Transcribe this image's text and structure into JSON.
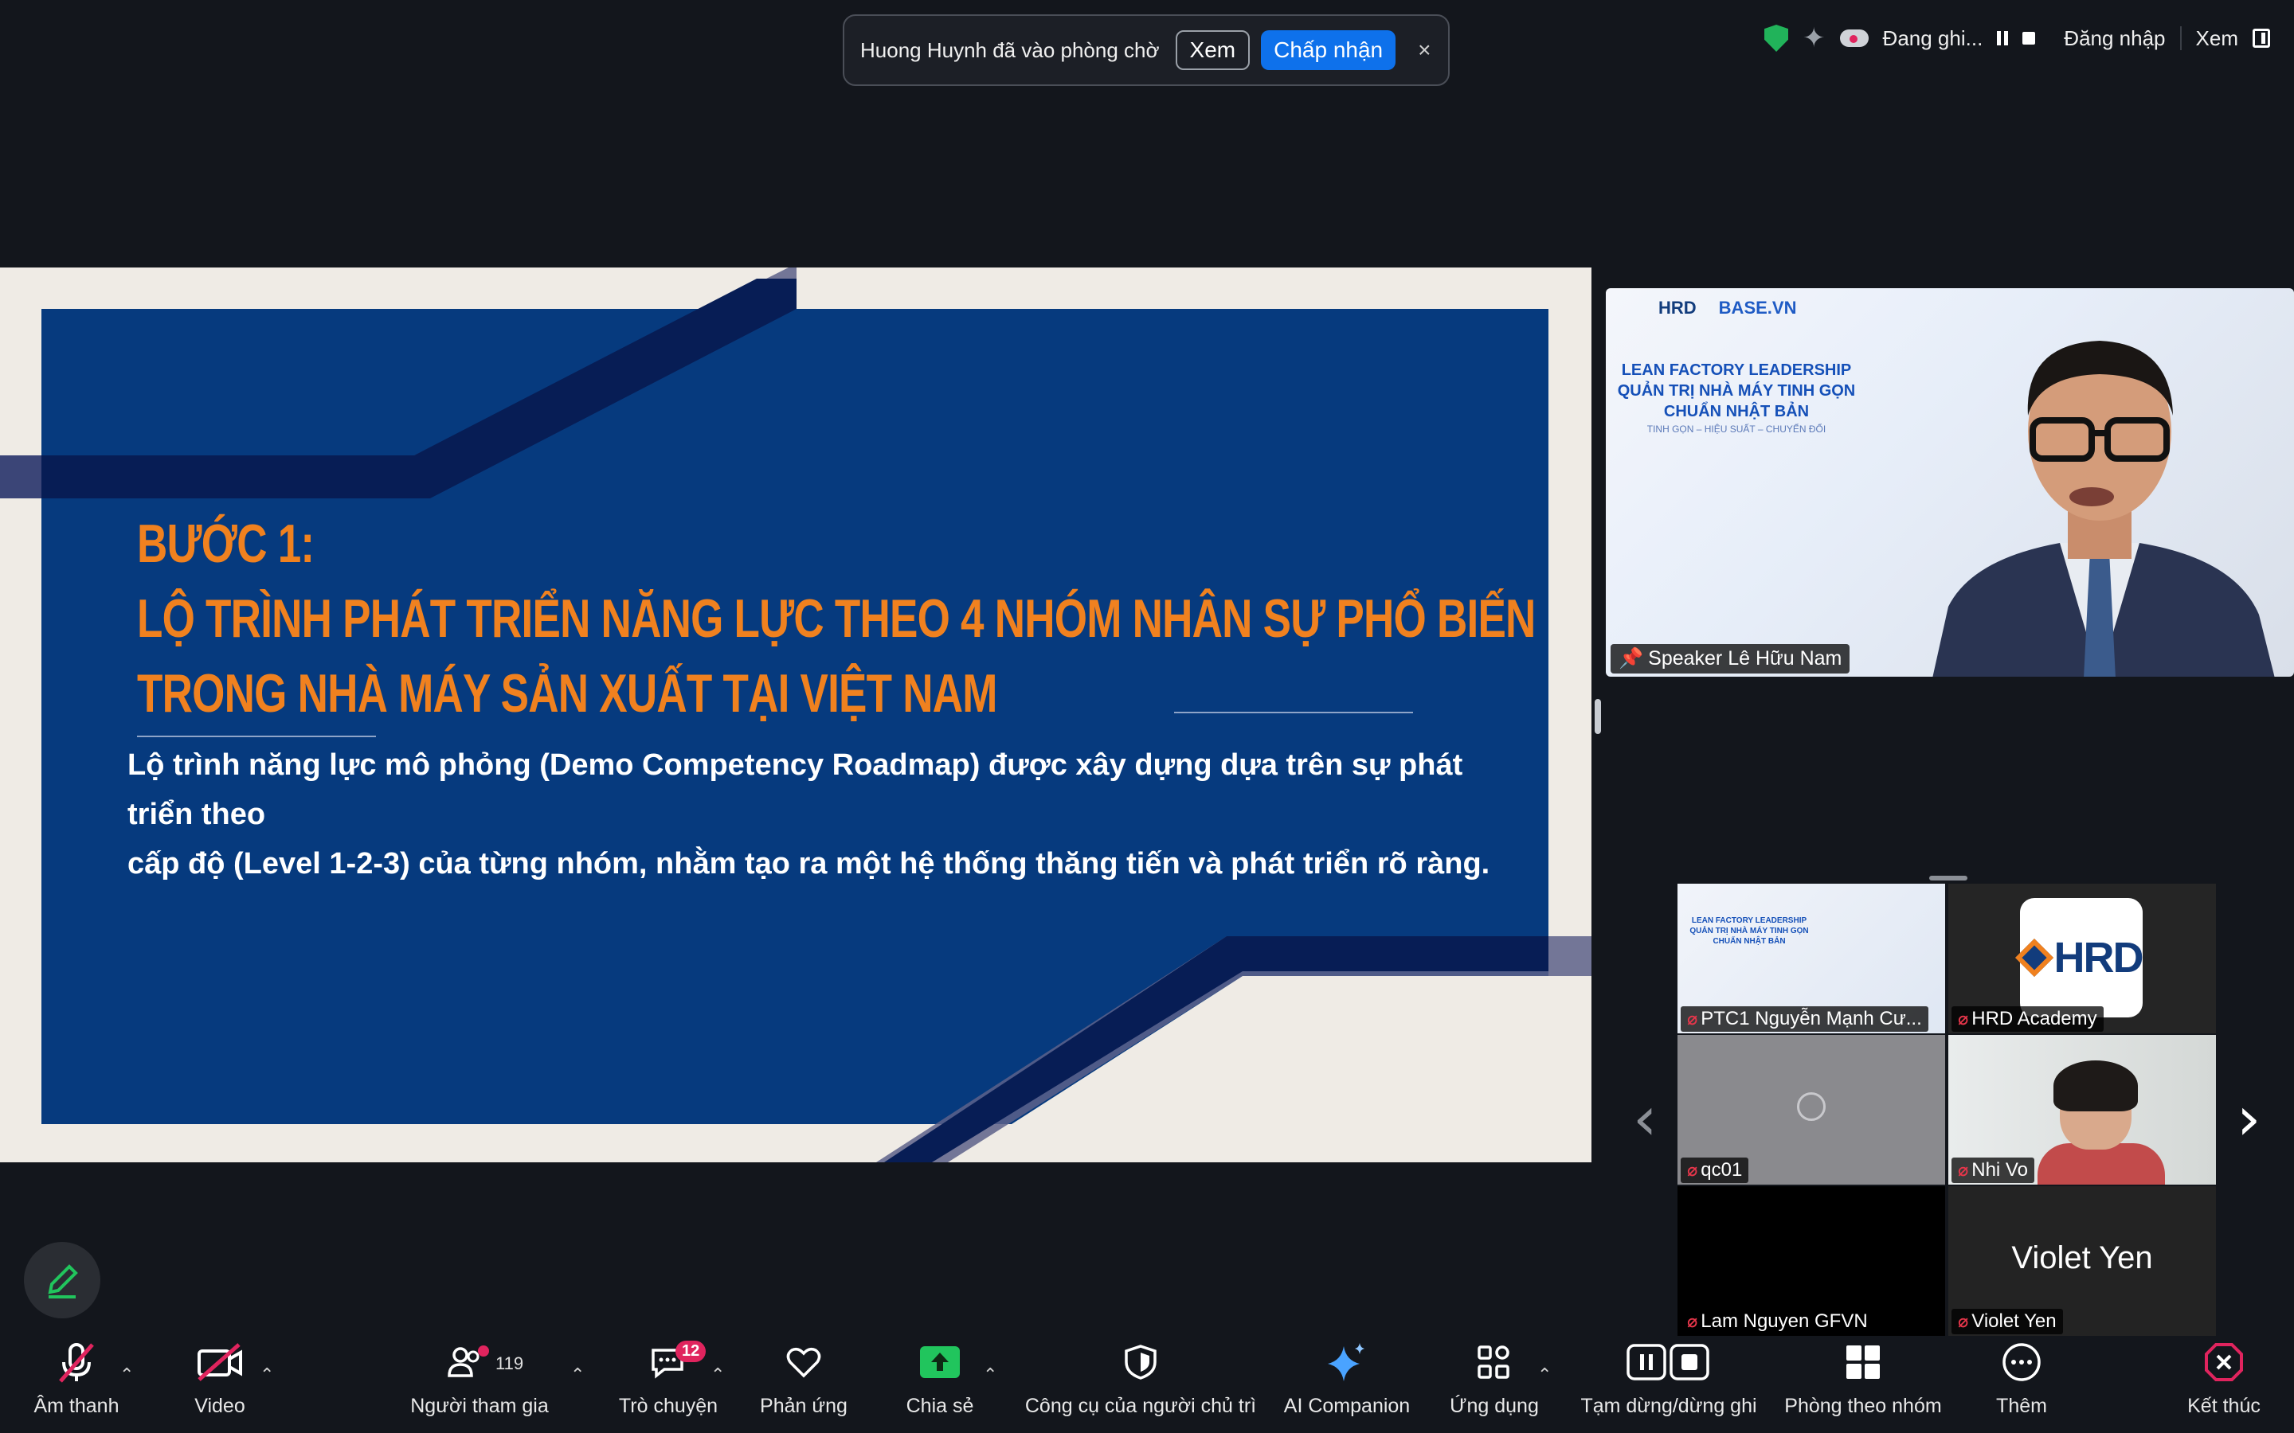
{
  "notification": {
    "message": "Huong Huynh đã vào phòng chờ",
    "view_label": "Xem",
    "accept_label": "Chấp nhận",
    "close_label": "×"
  },
  "status": {
    "recording_label": "Đang ghi...",
    "signin_label": "Đăng nhập",
    "view_label": "Xem"
  },
  "slide": {
    "title_line1": "BƯỚC 1:",
    "title_line2": "LỘ TRÌNH PHÁT TRIỂN NĂNG LỰC THEO 4 NHÓM NHÂN SỰ PHỔ BIẾN",
    "title_line3": "TRONG NHÀ MÁY SẢN XUẤT TẠI VIỆT NAM",
    "body_line1": "Lộ trình năng lực mô phỏng (Demo Competency Roadmap) được xây dựng dựa trên sự phát triển theo",
    "body_line2": "cấp độ (Level 1-2-3) của từng nhóm, nhằm tạo ra một hệ thống thăng tiến và phát triển rõ ràng."
  },
  "speaker": {
    "name": "Speaker Lê Hữu Nam",
    "logo_hrd": "HRD",
    "logo_base": "BASE.VN",
    "webinar_title": "LEAN FACTORY LEADERSHIP QUẢN TRỊ NHÀ MÁY TINH GỌN CHUẨN NHẬT BẢN",
    "webinar_sub": "TINH GỌN – HIỆU SUẤT – CHUYỂN ĐỔI"
  },
  "participants": [
    {
      "name": "PTC1 Nguyễn Mạnh Cư..."
    },
    {
      "name": "HRD Academy",
      "logo_text": "HRD"
    },
    {
      "name": "qc01"
    },
    {
      "name": "Nhi Vo"
    },
    {
      "name": "Lam Nguyen GFVN"
    },
    {
      "name": "Violet Yen",
      "display": "Violet Yen"
    }
  ],
  "toolbar": {
    "audio": "Âm thanh",
    "video": "Video",
    "participants": "Người tham gia",
    "participants_count": "119",
    "chat": "Trò chuyện",
    "chat_badge": "12",
    "reactions": "Phản ứng",
    "share": "Chia sẻ",
    "host_tools": "Công cụ của người chủ trì",
    "ai_companion": "AI Companion",
    "apps": "Ứng dụng",
    "pause_record": "Tạm dừng/dừng ghi",
    "breakout": "Phòng theo nhóm",
    "more": "Thêm",
    "end": "Kết thúc"
  },
  "colors": {
    "background": "#13161c",
    "slide_panel": "#063a7e",
    "slide_title": "#f0811f",
    "accept_button": "#0e71eb",
    "share_green": "#21c55d",
    "end_red": "#e0245e"
  }
}
